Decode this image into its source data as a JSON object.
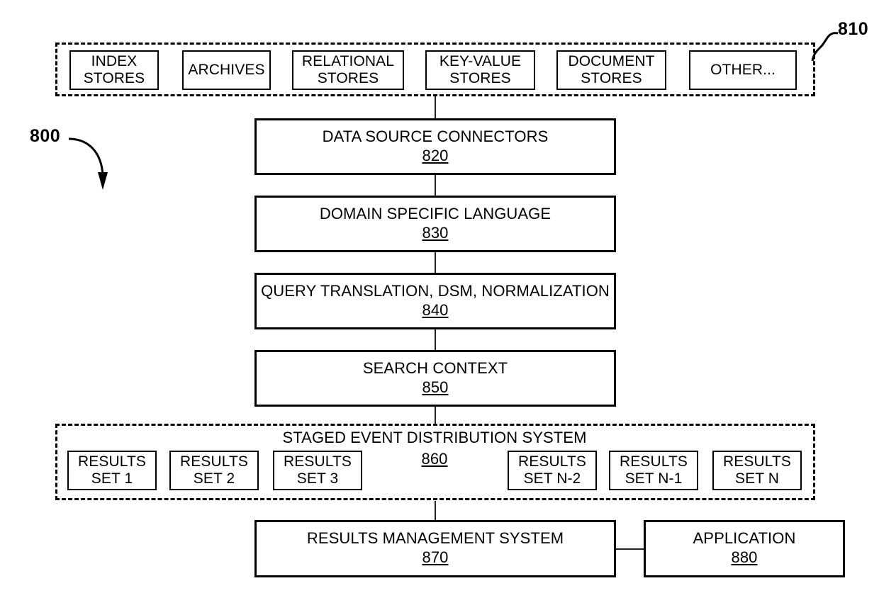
{
  "figure": {
    "callouts": [
      {
        "id": "810",
        "label": "810"
      },
      {
        "id": "800",
        "label": "800"
      }
    ]
  },
  "data_sources_group": {
    "ref": "810",
    "boxes": [
      {
        "line1": "INDEX",
        "line2": "STORES"
      },
      {
        "line1": "ARCHIVES",
        "line2": ""
      },
      {
        "line1": "RELATIONAL",
        "line2": "STORES"
      },
      {
        "line1": "KEY-VALUE",
        "line2": "STORES"
      },
      {
        "line1": "DOCUMENT",
        "line2": "STORES"
      },
      {
        "line1": "OTHER...",
        "line2": ""
      }
    ]
  },
  "pipeline": [
    {
      "title": "DATA SOURCE CONNECTORS",
      "ref": "820"
    },
    {
      "title": "DOMAIN SPECIFIC LANGUAGE",
      "ref": "830"
    },
    {
      "title": "QUERY TRANSLATION, DSM, NORMALIZATION",
      "ref": "840"
    },
    {
      "title": "SEARCH CONTEXT",
      "ref": "850"
    }
  ],
  "staged_event_group": {
    "title": "STAGED EVENT DISTRIBUTION SYSTEM",
    "ref": "860",
    "result_sets": [
      {
        "line1": "RESULTS",
        "line2": "SET 1"
      },
      {
        "line1": "RESULTS",
        "line2": "SET 2"
      },
      {
        "line1": "RESULTS",
        "line2": "SET 3"
      },
      {
        "line1": "RESULTS",
        "line2": "SET N-2"
      },
      {
        "line1": "RESULTS",
        "line2": "SET N-1"
      },
      {
        "line1": "RESULTS",
        "line2": "SET N"
      }
    ]
  },
  "bottom_row": [
    {
      "title": "RESULTS MANAGEMENT SYSTEM",
      "ref": "870"
    },
    {
      "title": "APPLICATION",
      "ref": "880"
    }
  ]
}
